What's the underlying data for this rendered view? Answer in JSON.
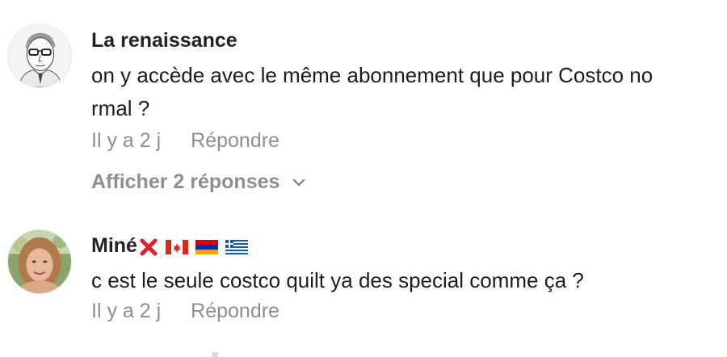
{
  "comments": [
    {
      "username": "La renaissance",
      "text_line1": "on y accède avec le même abonnement que pour Costco no",
      "text_line2": "rmal ?",
      "time": "Il y a 2 j",
      "reply_label": "Répondre",
      "view_replies": "Afficher 2 réponses",
      "avatar": "avatar-man-glasses-sketch"
    },
    {
      "username": "Miné",
      "flags": [
        "cross-mark-emoji",
        "canada-flag",
        "armenia-flag",
        "greece-flag"
      ],
      "text": "c est le seule costco quilt ya des special comme ça ?",
      "time": "Il y a 2 j",
      "reply_label": "Répondre",
      "avatar": "avatar-woman-photo"
    }
  ],
  "colors": {
    "primary_text": "#1c1c1c",
    "secondary_text": "#8e8e8e"
  }
}
